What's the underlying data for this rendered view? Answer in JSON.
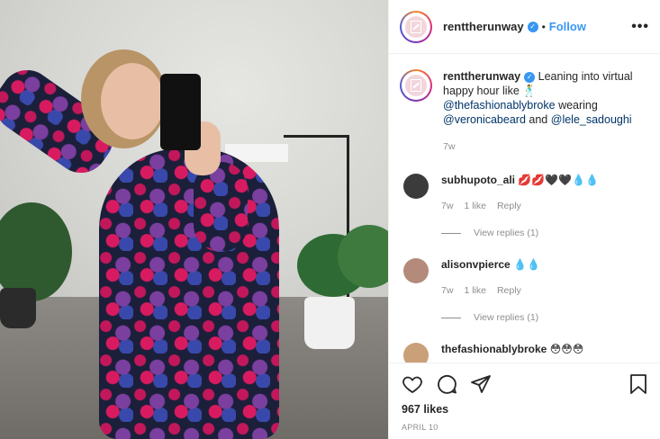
{
  "post": {
    "username": "renttherunway",
    "follow_label": "Follow",
    "separator": "•",
    "more_label": "•••"
  },
  "caption": {
    "username": "renttherunway",
    "text": "Leaning into virtual happy hour like 🕺",
    "mention1": "@thefashionablybroke",
    "text2": "wearing",
    "mention2": "@veronicabeard",
    "text3": "and",
    "mention3": "@lele_sadoughi",
    "time": "7w"
  },
  "comments": [
    {
      "username": "subhupoto_ali",
      "text": "💋💋🖤🖤💧💧",
      "time": "7w",
      "likes": "1 like",
      "reply_label": "Reply",
      "view_replies": "View replies (1)",
      "avatar_color": "#3b3b3b"
    },
    {
      "username": "alisonvpierce",
      "text": "💧💧",
      "time": "7w",
      "likes": "1 like",
      "reply_label": "Reply",
      "view_replies": "View replies (1)",
      "avatar_color": "#b48a7a"
    },
    {
      "username": "thefashionablybroke",
      "text": "😳😳😳",
      "avatar_color": "#caa078"
    }
  ],
  "footer": {
    "likes": "967 likes",
    "date": "APRIL 10"
  },
  "icons": [
    "heart-icon",
    "comment-icon",
    "share-icon",
    "bookmark-icon",
    "verified-icon",
    "more-icon"
  ],
  "colors": {
    "accent": "#3897f0",
    "muted": "#8e8e8e",
    "text": "#262626"
  }
}
